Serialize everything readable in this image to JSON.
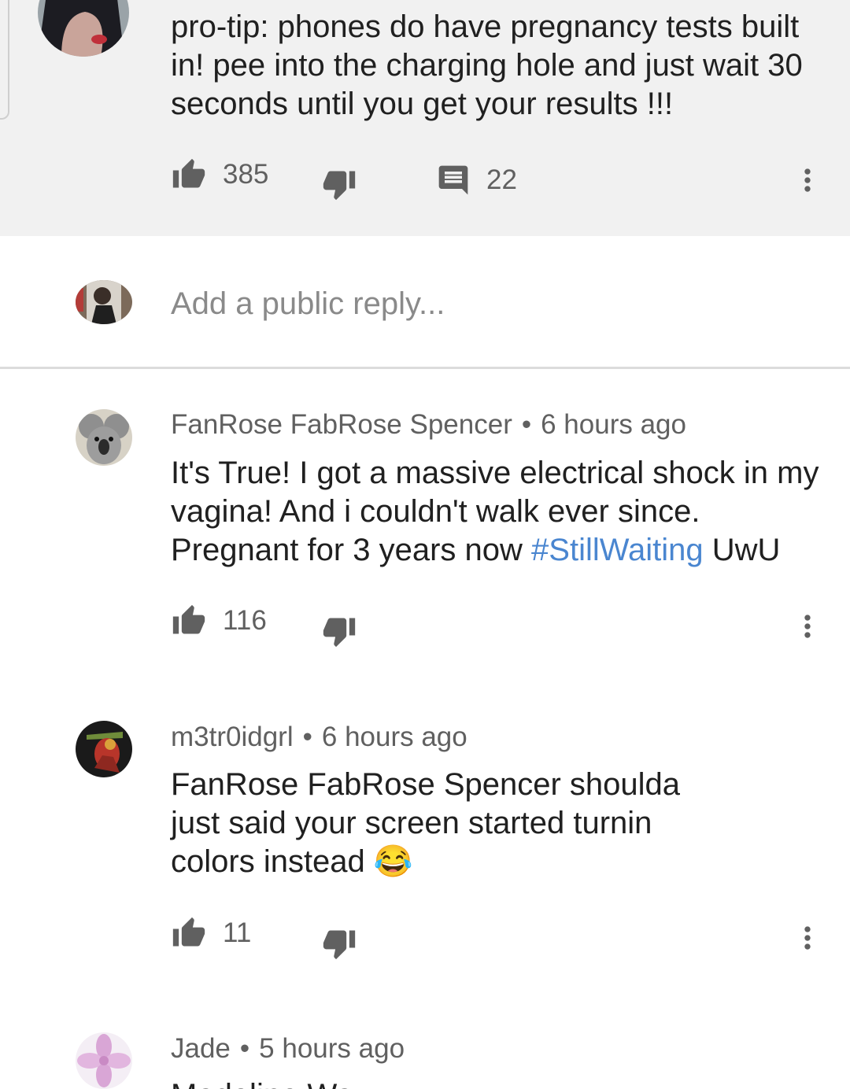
{
  "top_comment": {
    "text": "pro-tip: phones do have pregnancy tests built in! pee into the charging hole and just wait 30 seconds until you get your results !!!",
    "likes": "385",
    "replies": "22"
  },
  "reply_box": {
    "placeholder": "Add a public reply..."
  },
  "replies": [
    {
      "author": "FanRose FabRose Spencer",
      "separator": "•",
      "time": "6 hours ago",
      "text_before": "It's True! I got a massive electrical shock in my vagina! And i couldn't walk ever since. Pregnant for 3 years now ",
      "hashtag": "#StillWaiting",
      "text_after": " UwU",
      "likes": "116"
    },
    {
      "author": "m3tr0idgrl",
      "separator": "•",
      "time": "6 hours ago",
      "text": "FanRose FabRose Spencer shoulda just said your screen started turnin colors instead ",
      "emoji": "😂",
      "likes": "11"
    },
    {
      "author": "Jade",
      "separator": "•",
      "time": "5 hours ago",
      "text": "Madeline Wa..."
    }
  ],
  "icons": {
    "like": "thumbs-up-icon",
    "dislike": "thumbs-down-icon",
    "reply": "comment-icon",
    "more": "more-vert-icon"
  },
  "colors": {
    "highlight_bg": "#f1f1f1",
    "hashtag": "#4a86d0",
    "text": "#202020",
    "meta": "#606060",
    "placeholder": "#8a8a8a"
  }
}
